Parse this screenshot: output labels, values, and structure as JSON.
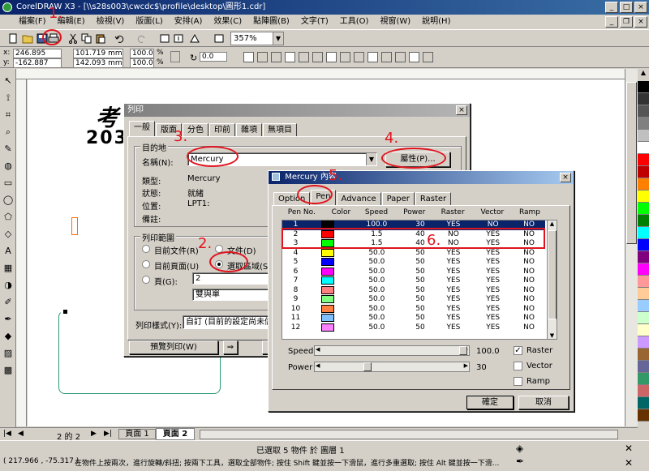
{
  "app": {
    "title": "CorelDRAW X3 - [\\\\s28s003\\cwcdc$\\profile\\desktop\\圖形1.cdr]",
    "menu": [
      "檔案(F)",
      "編輯(E)",
      "檢視(V)",
      "版面(L)",
      "安排(A)",
      "效果(C)",
      "點陣圖(B)",
      "文字(T)",
      "工具(O)",
      "視窗(W)",
      "說明(H)"
    ],
    "zoom": "357%"
  },
  "propbar": {
    "x_label": "x:",
    "x_value": "246.895 mm",
    "y_label": "y:",
    "y_value": "-162.887 mm",
    "w_value": "101.719 mm",
    "h_value": "142.093 mm",
    "scale_w": "100.0",
    "scale_h": "100.0",
    "pct": "%",
    "rotate": "0.0"
  },
  "canvas": {
    "text1": "考",
    "text2": "203"
  },
  "palette": [
    "#000000",
    "#333333",
    "#555555",
    "#808080",
    "#c0c0c0",
    "#ffffff",
    "#ff0000",
    "#c00000",
    "#ff8000",
    "#ffff00",
    "#00ff00",
    "#008000",
    "#00ffff",
    "#0000ff",
    "#800080",
    "#ff00ff",
    "#ff9999",
    "#ffcc99",
    "#99ccff",
    "#ccffcc",
    "#ffffcc",
    "#cc99ff",
    "#996633",
    "#666699",
    "#339966",
    "#cc6666",
    "#006666",
    "#663300"
  ],
  "pages": {
    "count": "2 的 2",
    "tab1": "頁面 1",
    "tab2": "頁面 2"
  },
  "status": {
    "selection": "已選取 5 物件 於 圖層 1",
    "coords": "( 217.966 , -75.317 )",
    "hint": "在物件上按兩次，進行旋轉/斜扭; 按兩下工具，選取全部物件; 按住 Shift 鍵並按一下滑鼠，進行多重選取; 按住 Alt 鍵並按一下滑..."
  },
  "print_dialog": {
    "title": "列印",
    "tabs": [
      "一般",
      "版面",
      "分色",
      "印前",
      "雜項",
      "無項目"
    ],
    "dest_group": "目的地",
    "name_label": "名稱(N):",
    "name_value": "Mercury",
    "properties_btn": "屬性(P)...",
    "type_label": "類型:",
    "type_value": "Mercury",
    "status_label": "狀態:",
    "status_value": "就緒",
    "where_label": "位置:",
    "where_value": "LPT1:",
    "comment_label": "備註:",
    "range_group": "列印範圍",
    "opt_current_doc": "目前文件(R)",
    "opt_document": "文件(D)",
    "opt_current_page": "目前頁面(U)",
    "opt_selection": "選取區域(S)",
    "opt_pages": "頁(G):",
    "pages_value": "2",
    "page_parity": "雙與單",
    "style_label": "列印樣式(Y):",
    "style_value": "自訂 (目前的設定尚未儲",
    "preview_btn": "預覽列印(W)",
    "arrow_btn": "⇒"
  },
  "mercury_dialog": {
    "title": "Mercury 內容",
    "tabs": [
      "Option",
      "Pen",
      "Advance",
      "Paper",
      "Raster"
    ],
    "columns": [
      "Pen No.",
      "Color",
      "Speed",
      "Power",
      "Raster",
      "Vector",
      "Ramp"
    ],
    "rows": [
      {
        "no": "1",
        "color": "#000000",
        "speed": "100.0",
        "power": "30",
        "raster": "YES",
        "vector": "NO",
        "ramp": "NO"
      },
      {
        "no": "2",
        "color": "#ff0000",
        "speed": "1.5",
        "power": "40",
        "raster": "NO",
        "vector": "YES",
        "ramp": "NO"
      },
      {
        "no": "3",
        "color": "#00ff00",
        "speed": "1.5",
        "power": "40",
        "raster": "NO",
        "vector": "YES",
        "ramp": "NO"
      },
      {
        "no": "4",
        "color": "#ffff00",
        "speed": "50.0",
        "power": "50",
        "raster": "YES",
        "vector": "YES",
        "ramp": "NO"
      },
      {
        "no": "5",
        "color": "#0000ff",
        "speed": "50.0",
        "power": "50",
        "raster": "YES",
        "vector": "YES",
        "ramp": "NO"
      },
      {
        "no": "6",
        "color": "#ff00ff",
        "speed": "50.0",
        "power": "50",
        "raster": "YES",
        "vector": "YES",
        "ramp": "NO"
      },
      {
        "no": "7",
        "color": "#00ffff",
        "speed": "50.0",
        "power": "50",
        "raster": "YES",
        "vector": "YES",
        "ramp": "NO"
      },
      {
        "no": "8",
        "color": "#ff8080",
        "speed": "50.0",
        "power": "50",
        "raster": "YES",
        "vector": "YES",
        "ramp": "NO"
      },
      {
        "no": "9",
        "color": "#80ff80",
        "speed": "50.0",
        "power": "50",
        "raster": "YES",
        "vector": "YES",
        "ramp": "NO"
      },
      {
        "no": "10",
        "color": "#ff8040",
        "speed": "50.0",
        "power": "50",
        "raster": "YES",
        "vector": "YES",
        "ramp": "NO"
      },
      {
        "no": "11",
        "color": "#80c0ff",
        "speed": "50.0",
        "power": "50",
        "raster": "YES",
        "vector": "YES",
        "ramp": "NO"
      },
      {
        "no": "12",
        "color": "#ff80ff",
        "speed": "50.0",
        "power": "50",
        "raster": "YES",
        "vector": "YES",
        "ramp": "NO"
      }
    ],
    "speed_label": "Speed",
    "speed_value": "100.0",
    "power_label": "Power",
    "power_value": "30",
    "chk_raster": "Raster",
    "chk_vector": "Vector",
    "chk_ramp": "Ramp",
    "speed_fraction": 1.0,
    "power_fraction": 0.3,
    "ok_btn": "確定",
    "cancel_btn": "取消"
  },
  "annotations": [
    "1.",
    "2.",
    "3.",
    "4.",
    "5.",
    "6."
  ],
  "accent": {
    "red": "#e0141e",
    "title_blue": "#0a246a"
  }
}
